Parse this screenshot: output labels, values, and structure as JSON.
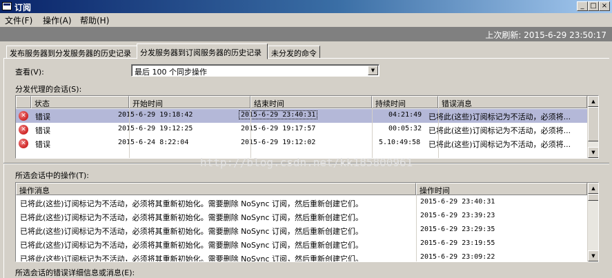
{
  "window": {
    "title": "订阅"
  },
  "menu": [
    {
      "label": "文件(F)"
    },
    {
      "label": "操作(A)"
    },
    {
      "label": "帮助(H)"
    }
  ],
  "status": {
    "last_refresh": "上次刷新: 2015-6-29 23:50:17"
  },
  "tabs": [
    {
      "label": "发布服务器到分发服务器的历史记录"
    },
    {
      "label": "分发服务器到订阅服务器的历史记录"
    },
    {
      "label": "未分发的命令"
    }
  ],
  "view": {
    "label": "查看(V):",
    "selected": "最后 100 个同步操作"
  },
  "sessions": {
    "label": "分发代理的会话(S):",
    "columns": [
      "状态",
      "开始时间",
      "结束时间",
      "持续时间",
      "错误消息"
    ],
    "rows": [
      {
        "status": "错误",
        "start": "2015-6-29 19:18:42",
        "end": "2015-6-29 23:40:31",
        "duration": "04:21:49",
        "error": "已将此(这些)订阅标记为不活动，必须将..."
      },
      {
        "status": "错误",
        "start": "2015-6-29 19:12:25",
        "end": "2015-6-29 19:17:57",
        "duration": "00:05:32",
        "error": "已将此(这些)订阅标记为不活动，必须将..."
      },
      {
        "status": "错误",
        "start": "2015-6-24 8:22:04",
        "end": "2015-6-29 19:12:02",
        "duration": "5.10:49:58",
        "error": "已将此(这些)订阅标记为不活动，必须将..."
      }
    ]
  },
  "actions": {
    "label": "所选会话中的操作(T):",
    "columns": [
      "操作消息",
      "操作时间"
    ],
    "rows": [
      {
        "message": "已将此(这些)订阅标记为不活动，必须将其重新初始化。需要删除 NoSync 订阅，然后重新创建它们。",
        "time": "2015-6-29 23:40:31"
      },
      {
        "message": "已将此(这些)订阅标记为不活动，必须将其重新初始化。需要删除 NoSync 订阅，然后重新创建它们。",
        "time": "2015-6-29 23:39:23"
      },
      {
        "message": "已将此(这些)订阅标记为不活动，必须将其重新初始化。需要删除 NoSync 订阅，然后重新创建它们。",
        "time": "2015-6-29 23:29:35"
      },
      {
        "message": "已将此(这些)订阅标记为不活动，必须将其重新初始化。需要删除 NoSync 订阅，然后重新创建它们。",
        "time": "2015-6-29 23:19:55"
      },
      {
        "message": "已将此(这些)订阅标记为不活动，必须将其重新初始化。需要删除 NoSync 订阅，然后重新创建它们。",
        "time": "2015-6-29 23:09:22"
      }
    ]
  },
  "details": {
    "label": "所选会话的错误详细信息或消息(E):"
  },
  "watermark": "http://blog.csdn.net/kk185800961",
  "colors": {
    "title_gradient_start": "#0a246a",
    "selected_row": "#b4b8d8",
    "error_icon": "#c00000",
    "status_bar": "#808080"
  },
  "icons": {
    "app": "window-icon",
    "status": "error-circle-icon"
  }
}
